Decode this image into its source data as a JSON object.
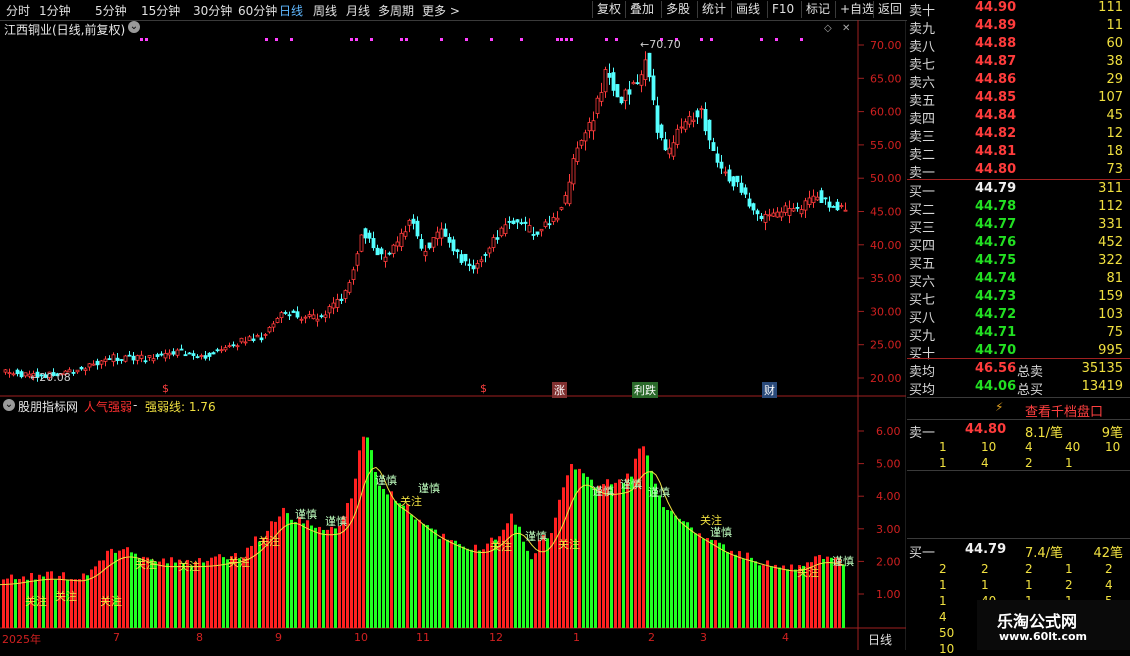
{
  "toolbar": {
    "periods": [
      "分时",
      "1分钟",
      "5分钟",
      "15分钟",
      "30分钟",
      "60分钟",
      "日线",
      "周线",
      "月线",
      "多周期",
      "更多"
    ],
    "active_period": "日线",
    "buttons": [
      "复权",
      "叠加",
      "多股",
      "统计",
      "画线",
      "F10",
      "标记",
      "+自选",
      "返回"
    ]
  },
  "chart_title": "江西铜业(日线,前复权)",
  "price_axis": [
    "70.00",
    "65.00",
    "60.00",
    "55.00",
    "50.00",
    "45.00",
    "40.00",
    "35.00",
    "30.00",
    "25.00",
    "20.00"
  ],
  "price_annotations": {
    "high": "70.70",
    "low": "20.08"
  },
  "event_marks": [
    "$",
    "$",
    "涨",
    "利跌",
    "财"
  ],
  "indicator": {
    "name": "股朋指标网",
    "series1": "人气强弱",
    "series2_label": "强弱线: 1.76",
    "axis": [
      "6.00",
      "5.00",
      "4.00",
      "3.00",
      "2.00",
      "1.00"
    ],
    "signal_attention": "关注",
    "signal_caution": "谨慎"
  },
  "x_axis": [
    "2025年",
    "7",
    "8",
    "9",
    "10",
    "11",
    "12",
    "1",
    "2",
    "3",
    "4"
  ],
  "x_period_label": "日线",
  "orderbook": {
    "asks": [
      {
        "label": "卖十",
        "price": "44.90",
        "vol": "111"
      },
      {
        "label": "卖九",
        "price": "44.89",
        "vol": "11"
      },
      {
        "label": "卖八",
        "price": "44.88",
        "vol": "60"
      },
      {
        "label": "卖七",
        "price": "44.87",
        "vol": "38"
      },
      {
        "label": "卖六",
        "price": "44.86",
        "vol": "29"
      },
      {
        "label": "卖五",
        "price": "44.85",
        "vol": "107"
      },
      {
        "label": "卖四",
        "price": "44.84",
        "vol": "45"
      },
      {
        "label": "卖三",
        "price": "44.82",
        "vol": "12"
      },
      {
        "label": "卖二",
        "price": "44.81",
        "vol": "18"
      },
      {
        "label": "卖一",
        "price": "44.80",
        "vol": "73"
      }
    ],
    "bids": [
      {
        "label": "买一",
        "price": "44.79",
        "vol": "311"
      },
      {
        "label": "买二",
        "price": "44.78",
        "vol": "112"
      },
      {
        "label": "买三",
        "price": "44.77",
        "vol": "331"
      },
      {
        "label": "买四",
        "price": "44.76",
        "vol": "452"
      },
      {
        "label": "买五",
        "price": "44.75",
        "vol": "322"
      },
      {
        "label": "买六",
        "price": "44.74",
        "vol": "81"
      },
      {
        "label": "买七",
        "price": "44.73",
        "vol": "159"
      },
      {
        "label": "买八",
        "price": "44.72",
        "vol": "103"
      },
      {
        "label": "买九",
        "price": "44.71",
        "vol": "75"
      },
      {
        "label": "买十",
        "price": "44.70",
        "vol": "995"
      }
    ],
    "avg_sell": {
      "label": "卖均",
      "price": "46.56",
      "total_label": "总卖",
      "total": "35135"
    },
    "avg_buy": {
      "label": "买均",
      "price": "44.06",
      "total_label": "总买",
      "total": "13419"
    },
    "level1000_button": "查看千档盘口",
    "sell1_detail": {
      "label": "卖一",
      "price": "44.80",
      "per_order": "8.1/笔",
      "orders": "9笔",
      "row1": [
        "1",
        "10",
        "4",
        "40",
        "10"
      ],
      "row2": [
        "1",
        "4",
        "2",
        "1"
      ]
    },
    "buy1_detail": {
      "label": "买一",
      "price": "44.79",
      "per_order": "7.4/笔",
      "orders": "42笔",
      "row1": [
        "2",
        "2",
        "2",
        "1",
        "2"
      ],
      "row2": [
        "1",
        "1",
        "1",
        "2",
        "4"
      ],
      "row3": [
        "1",
        "40",
        "1",
        "1",
        "5"
      ],
      "row4": [
        "4"
      ],
      "row5": [
        "50"
      ],
      "row6": [
        "10"
      ]
    }
  },
  "watermark": {
    "title": "乐淘公式网",
    "url": "www.60lt.com"
  }
}
